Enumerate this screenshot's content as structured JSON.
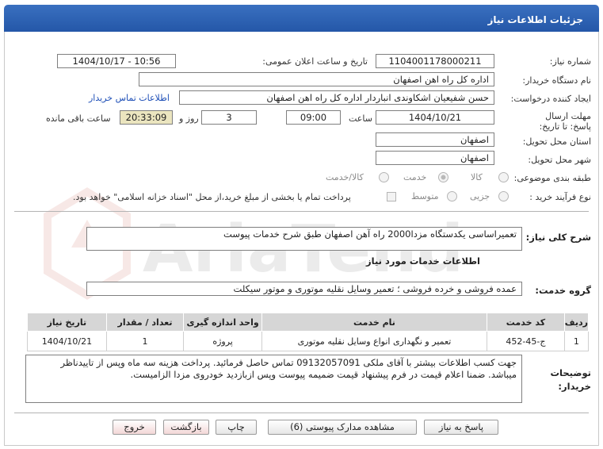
{
  "header": {
    "title": "جزئیات اطلاعات نیاز"
  },
  "labels": {
    "need_number": "شماره نیاز:",
    "announce_date": "تاریخ و ساعت اعلان عمومی:",
    "buyer_org": "نام دستگاه خریدار:",
    "requester": "ایجاد کننده درخواست:",
    "deadline": "مهلت ارسال پاسخ: تا تاریخ:",
    "hour": "ساعت",
    "day_and": "روز و",
    "remaining": "ساعت باقی مانده",
    "province": "استان محل تحویل:",
    "city": "شهر محل تحویل:",
    "category": "طبقه بندی موضوعی:",
    "process_type": "نوع فرآیند خرید :",
    "general_desc": "شرح کلی نیاز:",
    "services_info": "اطلاعات خدمات مورد نیاز",
    "service_group": "گروه خدمت:",
    "buyer_notes": "توضیحات خریدار:"
  },
  "fields": {
    "need_number": "1104001178000211",
    "announce_date": "1404/10/17 - 10:56",
    "buyer_org": "اداره کل راه اهن اصفهان",
    "requester": "حسن شفیعیان اشکاوندی انباردار اداره کل راه اهن اصفهان",
    "contact_link": "اطلاعات تماس خریدار",
    "deadline_date": "1404/10/21",
    "deadline_time": "09:00",
    "days": "3",
    "remaining_time": "20:33:09",
    "province": "اصفهان",
    "city": "اصفهان",
    "general_desc": "تعمیراساسی یکدستگاه مزدا2000 راه آهن اصفهان طبق شرح خدمات پیوست",
    "service_group": "عمده فروشی و خرده فروشی ؛ تعمیر وسایل نقلیه موتوری و موتور سیکلت",
    "buyer_notes_line1": "جهت کسب اطلاعات بیشتر با آقای ملکی 09132057091 تماس حاصل فرمائید. پرداخت هزینه سه ماه وپس از تاییدناظر",
    "buyer_notes_line2": "میباشد. ضمنا اعلام قیمت در فرم پیشنهاد قیمت ضمیمه پیوست  وپس ازبازدید خودروی مزدا الزامیست."
  },
  "category_options": [
    "کالا",
    "خدمت",
    "کالا/خدمت"
  ],
  "category_selected": "خدمت",
  "process_options": [
    "جزیی",
    "متوسط"
  ],
  "process_note": "پرداخت تمام یا بخشی از مبلغ خرید،از محل \"اسناد خزانه اسلامی\" خواهد بود.",
  "watermark": "AriaTender.net",
  "table": {
    "headers": [
      "ردیف",
      "کد خدمت",
      "نام خدمت",
      "واحد اندازه گیری",
      "تعداد / مقدار",
      "تاریخ نیاز"
    ],
    "rows": [
      [
        "1",
        "ج-45-452",
        "تعمیر و نگهداری انواع وسایل نقلیه موتوری",
        "پروژه",
        "1",
        "1404/10/21"
      ]
    ]
  },
  "buttons": {
    "reply": "پاسخ به نیاز",
    "view_docs": "مشاهده مدارک پیوستی (6)",
    "print": "چاپ",
    "back": "بازگشت",
    "exit": "خروج"
  }
}
